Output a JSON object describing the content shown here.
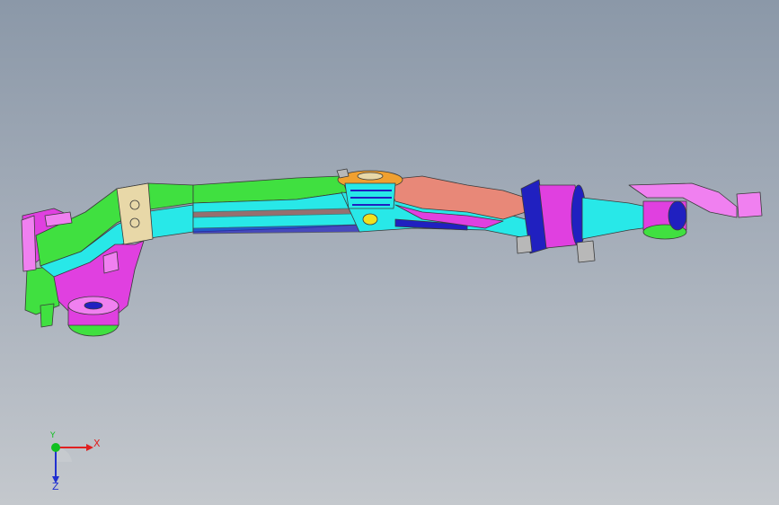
{
  "triad": {
    "x_label": "X",
    "y_label": "Y",
    "z_label": "Z",
    "colors": {
      "x": "#e02020",
      "y": "#10c020",
      "z": "#2030d0"
    }
  },
  "viewport": {
    "background_top": "#8b98a8",
    "background_bottom": "#c4c8cd"
  },
  "model": {
    "part_colors": {
      "green": "#40e040",
      "cyan": "#28e8e8",
      "magenta": "#e040e0",
      "salmon": "#e88878",
      "navy": "#2020c0",
      "pink": "#f080f0",
      "orange": "#f0a030",
      "yellow": "#f0e020",
      "tan": "#e8d8a8"
    }
  }
}
